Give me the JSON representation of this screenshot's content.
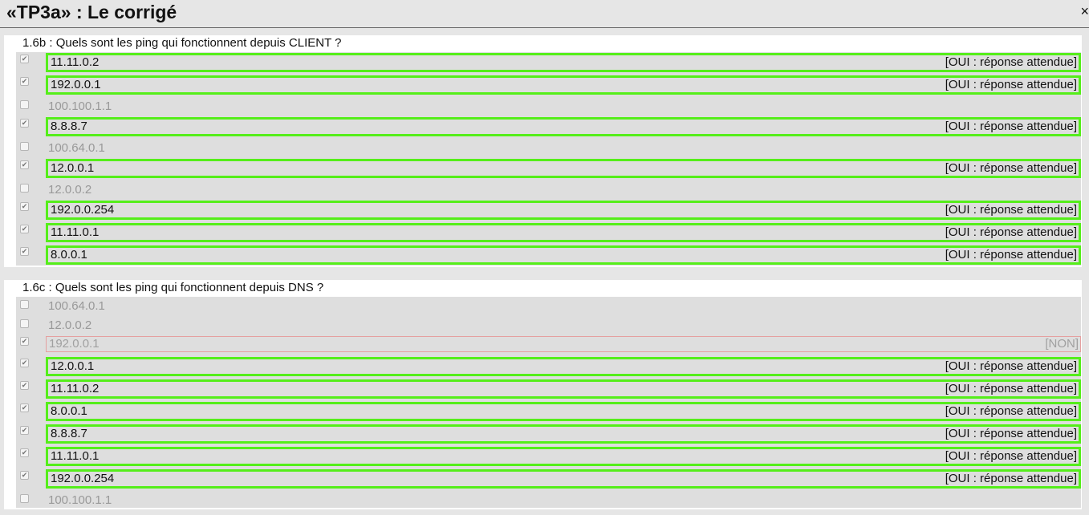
{
  "header": {
    "title": "«TP3a» : Le corrigé",
    "close_label": "×"
  },
  "questions": [
    {
      "title": "1.6b : Quels sont les ping qui fonctionnent depuis CLIENT ?",
      "answers": [
        {
          "label": "11.11.0.2",
          "checked": true,
          "status": "ok",
          "verdict": "[OUI : réponse attendue]"
        },
        {
          "label": "192.0.0.1",
          "checked": true,
          "status": "ok",
          "verdict": "[OUI : réponse attendue]"
        },
        {
          "label": "100.100.1.1",
          "checked": false,
          "status": "off",
          "verdict": ""
        },
        {
          "label": "8.8.8.7",
          "checked": true,
          "status": "ok",
          "verdict": "[OUI : réponse attendue]"
        },
        {
          "label": "100.64.0.1",
          "checked": false,
          "status": "off",
          "verdict": ""
        },
        {
          "label": "12.0.0.1",
          "checked": true,
          "status": "ok",
          "verdict": "[OUI : réponse attendue]"
        },
        {
          "label": "12.0.0.2",
          "checked": false,
          "status": "off",
          "verdict": ""
        },
        {
          "label": "192.0.0.254",
          "checked": true,
          "status": "ok",
          "verdict": "[OUI : réponse attendue]"
        },
        {
          "label": "11.11.0.1",
          "checked": true,
          "status": "ok",
          "verdict": "[OUI : réponse attendue]"
        },
        {
          "label": "8.0.0.1",
          "checked": true,
          "status": "ok",
          "verdict": "[OUI : réponse attendue]"
        }
      ]
    },
    {
      "title": "1.6c : Quels sont les ping qui fonctionnent depuis DNS ?",
      "answers": [
        {
          "label": "100.64.0.1",
          "checked": false,
          "status": "off",
          "verdict": ""
        },
        {
          "label": "12.0.0.2",
          "checked": false,
          "status": "off",
          "verdict": ""
        },
        {
          "label": "192.0.0.1",
          "checked": true,
          "status": "bad",
          "verdict": "[NON]"
        },
        {
          "label": "12.0.0.1",
          "checked": true,
          "status": "ok",
          "verdict": "[OUI : réponse attendue]"
        },
        {
          "label": "11.11.0.2",
          "checked": true,
          "status": "ok",
          "verdict": "[OUI : réponse attendue]"
        },
        {
          "label": "8.0.0.1",
          "checked": true,
          "status": "ok",
          "verdict": "[OUI : réponse attendue]"
        },
        {
          "label": "8.8.8.7",
          "checked": true,
          "status": "ok",
          "verdict": "[OUI : réponse attendue]"
        },
        {
          "label": "11.11.0.1",
          "checked": true,
          "status": "ok",
          "verdict": "[OUI : réponse attendue]"
        },
        {
          "label": "192.0.0.254",
          "checked": true,
          "status": "ok",
          "verdict": "[OUI : réponse attendue]"
        },
        {
          "label": "100.100.1.1",
          "checked": false,
          "status": "off",
          "verdict": ""
        }
      ]
    }
  ],
  "colors": {
    "correct_border": "#55ee1a",
    "wrong_border": "#e5a0a0",
    "answers_background": "#dedede",
    "page_background": "#e6e6e6"
  }
}
